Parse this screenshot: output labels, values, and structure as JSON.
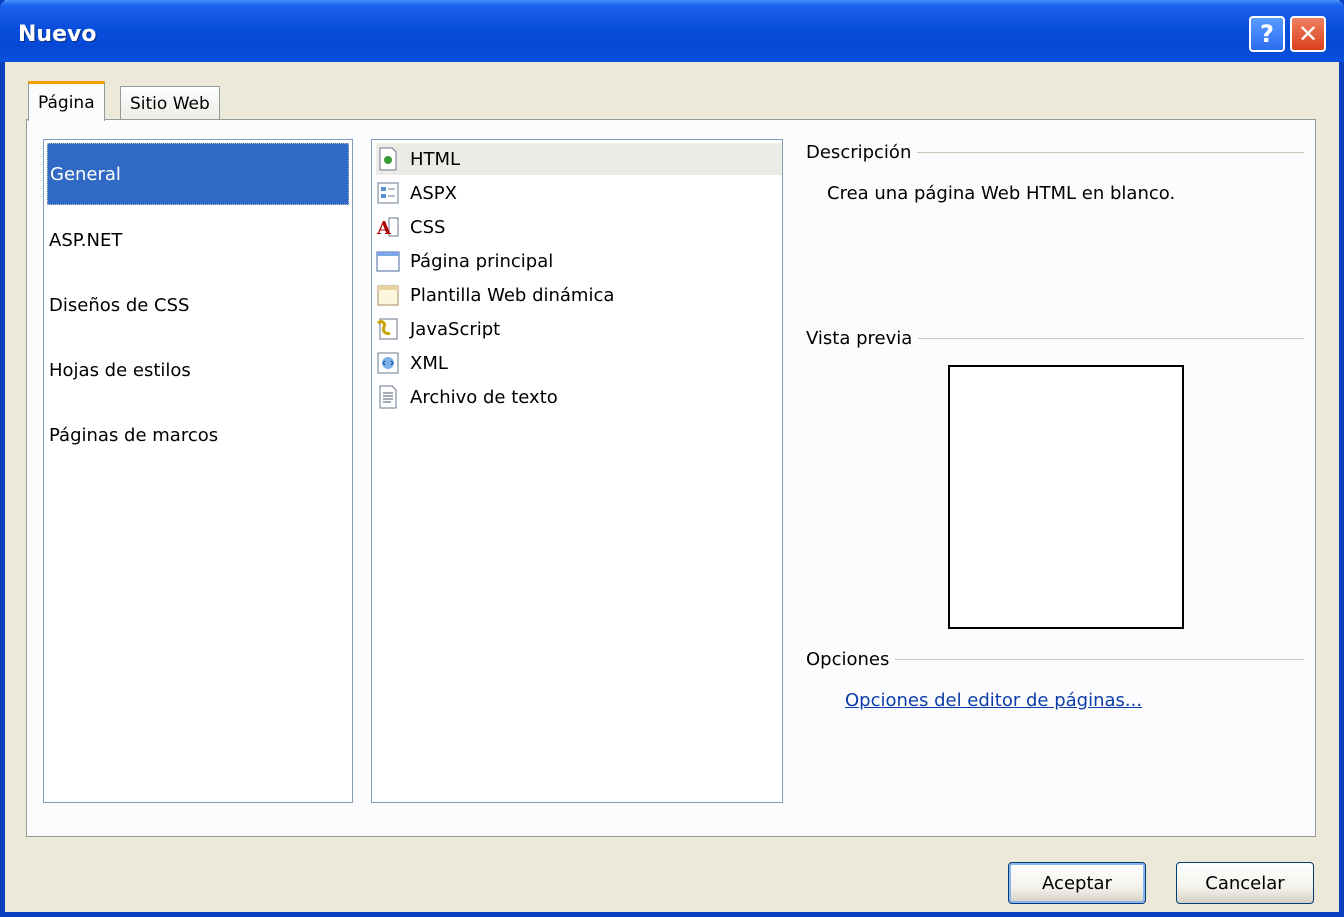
{
  "window": {
    "title": "Nuevo",
    "help_label": "?",
    "close_label": "✕"
  },
  "tabs": [
    {
      "label": "Página",
      "selected": true
    },
    {
      "label": "Sitio Web",
      "selected": false
    }
  ],
  "categories": [
    {
      "label": "General",
      "selected": true
    },
    {
      "label": "ASP.NET",
      "selected": false
    },
    {
      "label": "Diseños de CSS",
      "selected": false
    },
    {
      "label": "Hojas de estilos",
      "selected": false
    },
    {
      "label": "Páginas de marcos",
      "selected": false
    }
  ],
  "templates": [
    {
      "label": "HTML",
      "icon": "html-page-icon",
      "selected": true
    },
    {
      "label": "ASPX",
      "icon": "aspx-page-icon",
      "selected": false
    },
    {
      "label": "CSS",
      "icon": "css-file-icon",
      "selected": false
    },
    {
      "label": "Página principal",
      "icon": "master-page-icon",
      "selected": false
    },
    {
      "label": "Plantilla Web dinámica",
      "icon": "dynamic-template-icon",
      "selected": false
    },
    {
      "label": "JavaScript",
      "icon": "javascript-file-icon",
      "selected": false
    },
    {
      "label": "XML",
      "icon": "xml-file-icon",
      "selected": false
    },
    {
      "label": "Archivo de texto",
      "icon": "text-file-icon",
      "selected": false
    }
  ],
  "description": {
    "title": "Descripción",
    "text": "Crea una página Web HTML en blanco."
  },
  "preview": {
    "title": "Vista previa"
  },
  "options": {
    "title": "Opciones",
    "link": "Opciones del editor de páginas..."
  },
  "buttons": {
    "ok": "Aceptar",
    "cancel": "Cancelar"
  },
  "colors": {
    "titlebar": "#0a4fdc",
    "selection": "#316ac5",
    "link": "#0b3ea8",
    "face": "#ece9d8"
  }
}
